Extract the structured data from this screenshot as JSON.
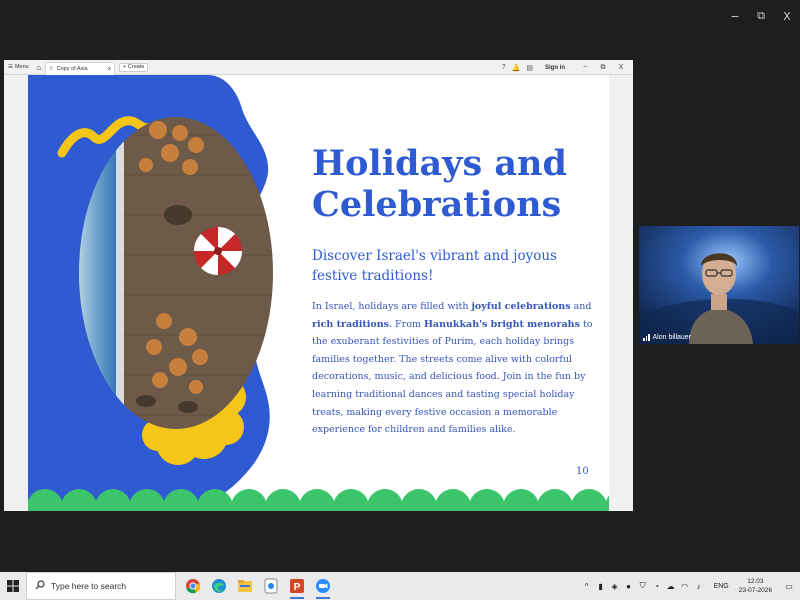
{
  "window_controls": {
    "minimize": "−",
    "restore": "⧉",
    "close": "X"
  },
  "browser": {
    "menu_label": "Menu",
    "tab_title": "Copy of Asia",
    "tab_close": "x",
    "create_label": "Create",
    "sign_in": "Sign in",
    "win_minimize": "−",
    "win_restore": "⧉",
    "win_close": "X"
  },
  "slide": {
    "title_line1": "Holidays and",
    "title_line2": "Celebrations",
    "subtitle_line1": "Discover Israel's vibrant and joyous",
    "subtitle_line2": "festive traditions!",
    "body": [
      {
        "text": "In Israel, holidays are filled with ",
        "bold": false
      },
      {
        "text": "joyful celebrations",
        "bold": true
      },
      {
        "text": " and ",
        "bold": false
      },
      {
        "text": "rich traditions",
        "bold": true
      },
      {
        "text": ". From ",
        "bold": false
      },
      {
        "text": "Hanukkah's bright menorahs",
        "bold": true
      },
      {
        "text": " to the exuberant festivities of Purim, each holiday brings families together. The streets come alive with colorful decorations, music, and delicious food. Join in the fun by learning traditional dances and tasting special holiday treats, making every festive occasion a memorable experience for children and families alike.",
        "bold": false
      }
    ],
    "page_number": "10",
    "colors": {
      "blue": "#2f5bd2",
      "yellow": "#f5c518",
      "green": "#3cc46a"
    }
  },
  "video": {
    "participant_name": "Alon billauer"
  },
  "taskbar": {
    "search_placeholder": "Type here to search",
    "apps": [
      "chrome-icon",
      "edge-icon",
      "file-explorer-icon",
      "app-icon",
      "powerpoint-icon",
      "zoom-icon"
    ],
    "language": "ENG",
    "time": "12:03",
    "date": "23-07-2026"
  }
}
